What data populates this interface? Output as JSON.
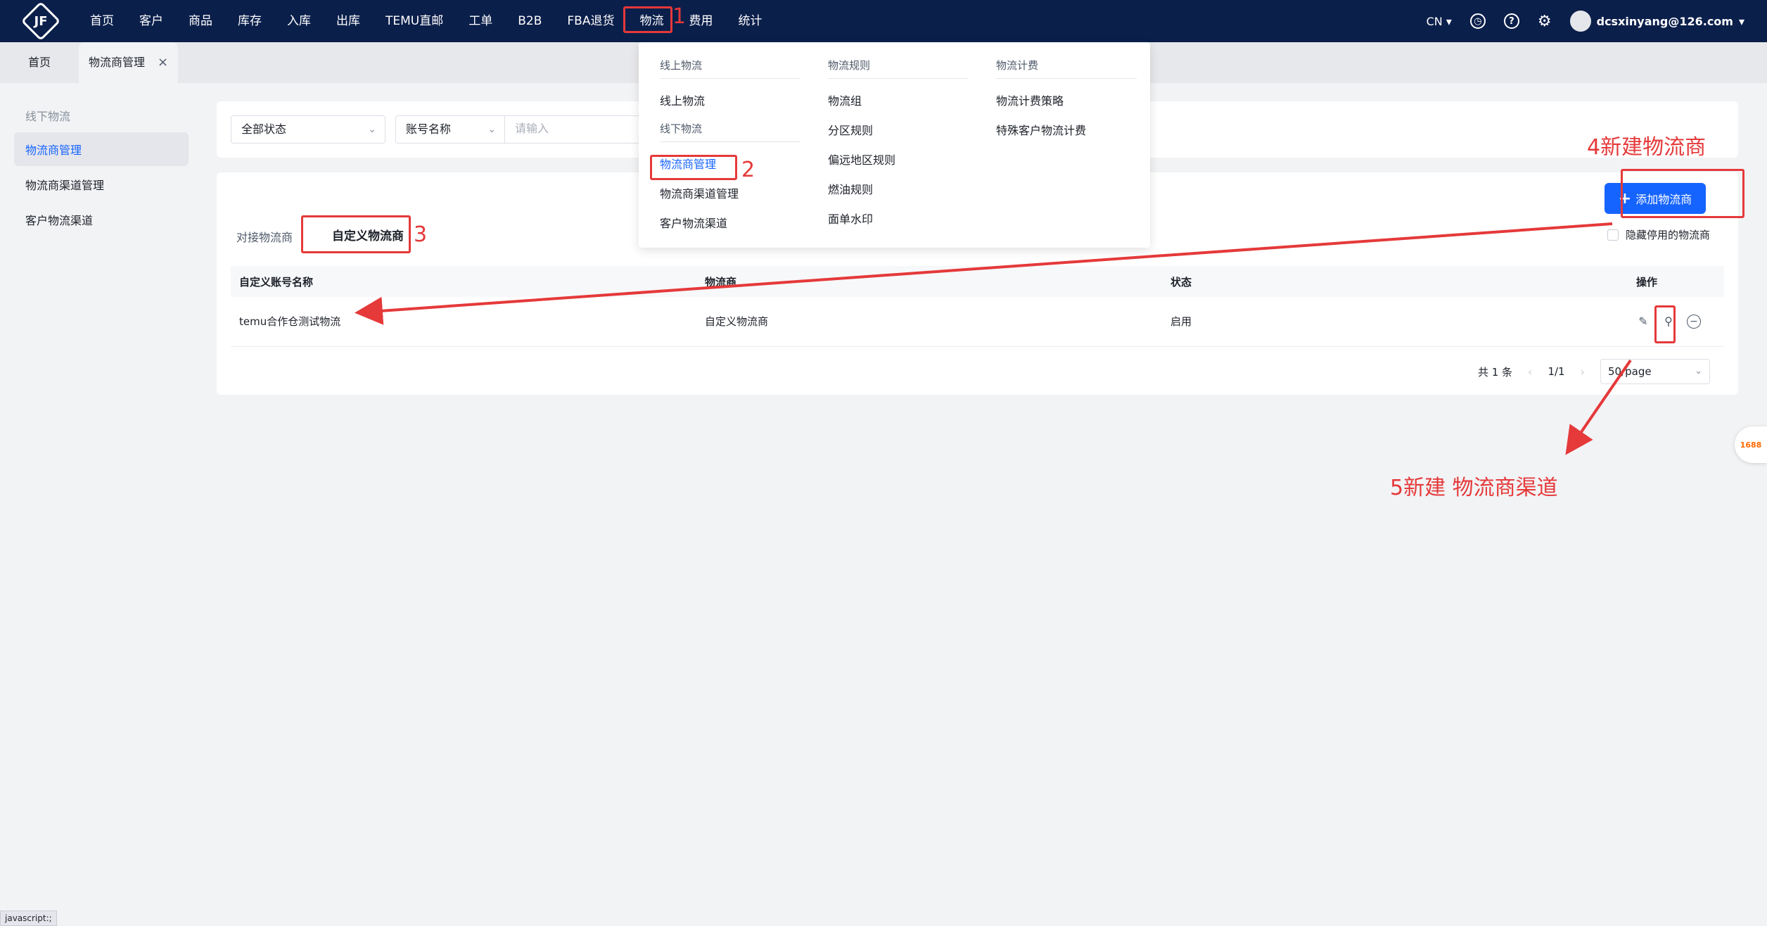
{
  "logo": "JF",
  "nav": [
    "首页",
    "客户",
    "商品",
    "库存",
    "入库",
    "出库",
    "TEMU直邮",
    "工单",
    "B2B",
    "FBA退货",
    "物流",
    "费用",
    "统计"
  ],
  "topright": {
    "lang": "CN",
    "user": "dcsxinyang@126.com"
  },
  "tabs": {
    "home": "首页",
    "current": "物流商管理",
    "close": "×"
  },
  "sidebar": {
    "group": "线下物流",
    "items": [
      "物流商管理",
      "物流商渠道管理",
      "客户物流渠道"
    ]
  },
  "filter": {
    "status": "全部状态",
    "account": "账号名称",
    "placeholder": "请输入"
  },
  "subtabs": [
    "对接物流商",
    "自定义物流商"
  ],
  "add_button": "添加物流商",
  "hide_disabled": "隐藏停用的物流商",
  "table": {
    "headers": [
      "自定义账号名称",
      "物流商",
      "状态",
      "操作"
    ],
    "rows": [
      {
        "name": "temu合作仓测试物流",
        "carrier": "自定义物流商",
        "status": "启用"
      }
    ]
  },
  "pager": {
    "total": "共 1 条",
    "page": "1/1",
    "size": "50/page"
  },
  "mega": {
    "col1": {
      "head1": "线上物流",
      "items1": [
        "线上物流"
      ],
      "head2": "线下物流",
      "items2": [
        "物流商管理",
        "物流商渠道管理",
        "客户物流渠道"
      ]
    },
    "col2": {
      "head": "物流规则",
      "items": [
        "物流组",
        "分区规则",
        "偏远地区规则",
        "燃油规则",
        "面单水印"
      ]
    },
    "col3": {
      "head": "物流计费",
      "items": [
        "物流计费策略",
        "特殊客户物流计费"
      ]
    }
  },
  "annotations": [
    "1",
    "2",
    "3",
    "4新建物流商",
    "5新建 物流商渠道"
  ],
  "status_tip": "javascript:;",
  "floater": "1688",
  "colors": {
    "nav_bg": "#0b1f4b",
    "primary": "#1664ff",
    "annotation": "#e5393a"
  }
}
